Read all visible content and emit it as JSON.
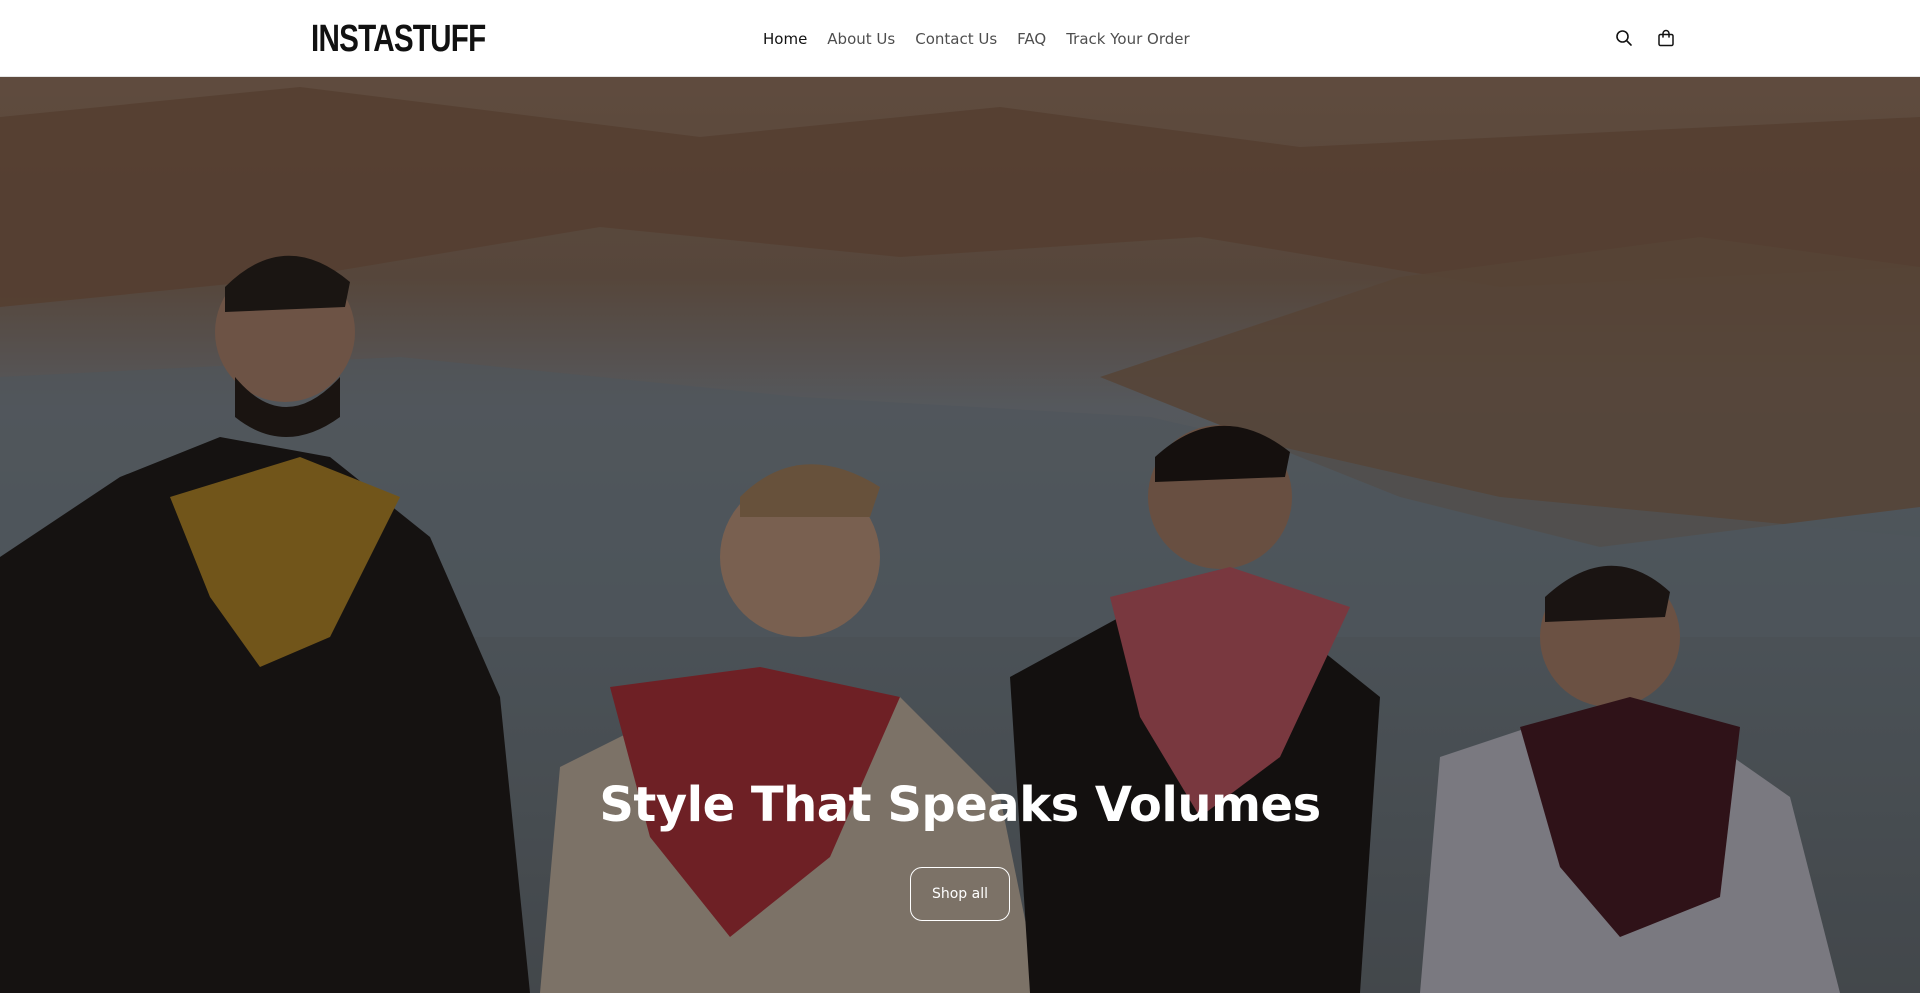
{
  "header": {
    "logo": "INSTASTUFF",
    "nav": [
      {
        "label": "Home"
      },
      {
        "label": "About Us"
      },
      {
        "label": "Contact Us"
      },
      {
        "label": "FAQ"
      },
      {
        "label": "Track Your Order"
      }
    ],
    "icons": {
      "search": "search-icon",
      "cart": "cart-icon"
    }
  },
  "hero": {
    "title": "Style That Speaks Volumes",
    "button_label": "Shop all"
  },
  "colors": {
    "header_bg": "#ffffff",
    "text": "#121212",
    "hero_text": "#ffffff"
  }
}
